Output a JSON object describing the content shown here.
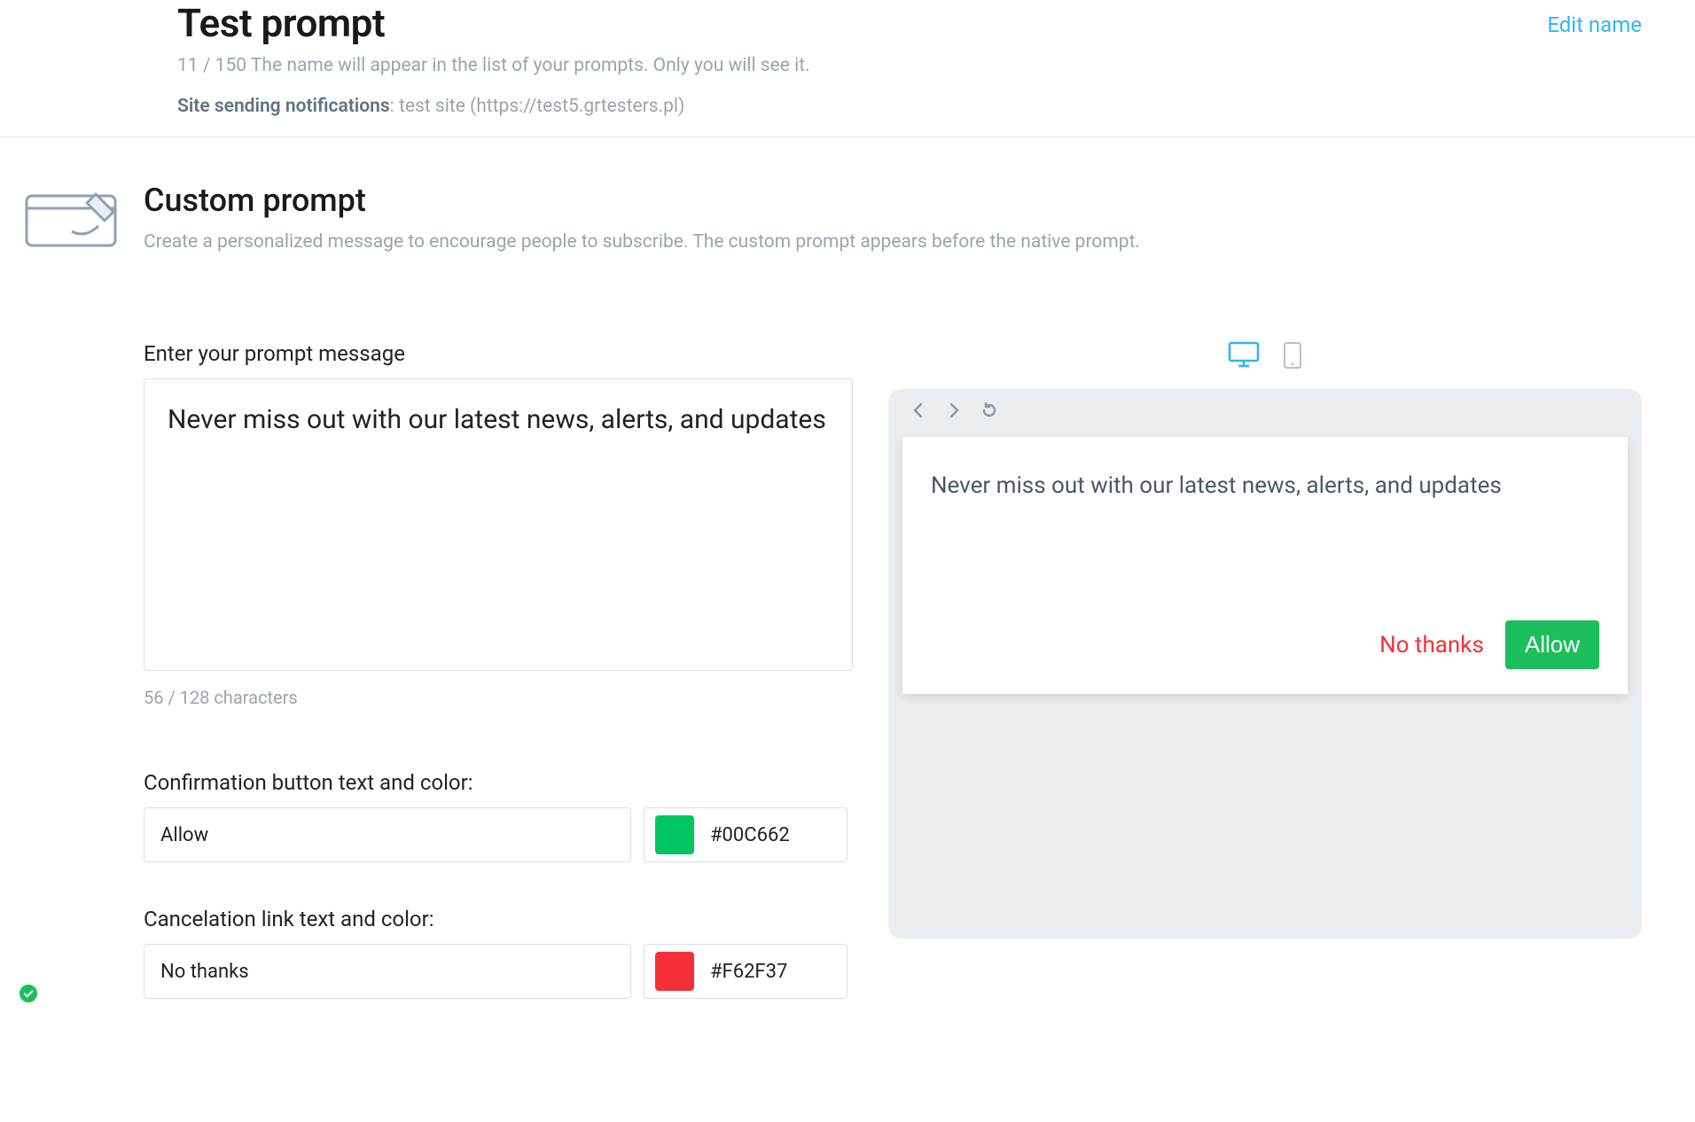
{
  "header": {
    "title": "Test prompt",
    "edit_link": "Edit name",
    "name_counter": "11 / 150",
    "name_hint": "The name will appear in the list of your prompts. Only you will see it.",
    "site_label": "Site sending notifications",
    "site_value": ": test site (https://test5.grtesters.pl)"
  },
  "section": {
    "title": "Custom prompt",
    "desc": "Create a personalized message to encourage people to subscribe. The custom prompt appears before the native prompt."
  },
  "form": {
    "message_label": "Enter your prompt message",
    "message_value": "Never miss out with our latest news, alerts, and updates",
    "message_counter": "56 / 128 characters",
    "confirm_label": "Confirmation button text and color:",
    "confirm_text": "Allow",
    "confirm_color": "#00C662",
    "cancel_label": "Cancelation link text and color:",
    "cancel_text": "No thanks",
    "cancel_color": "#F62F37"
  },
  "preview": {
    "message": "Never miss out with our latest news, alerts, and updates",
    "cancel_text": "No thanks",
    "confirm_text": "Allow",
    "confirm_bg": "#1BBF5C",
    "cancel_color_style": "color:#F62F37",
    "allow_style": "background:#1BBF5C"
  }
}
